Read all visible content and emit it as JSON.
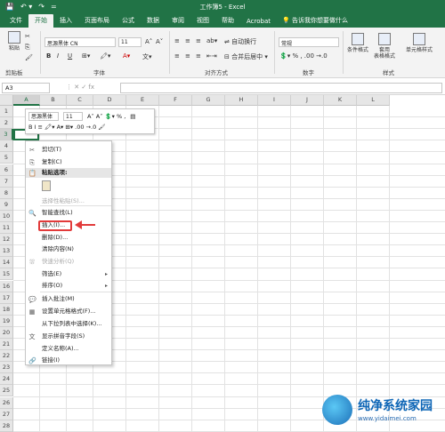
{
  "window": {
    "title": "工作簿5 - Excel"
  },
  "qat": [
    "💾",
    "↶ ▾",
    "↷",
    "="
  ],
  "tabs": [
    "文件",
    "开始",
    "插入",
    "页面布局",
    "公式",
    "数据",
    "审阅",
    "视图",
    "帮助",
    "Acrobat"
  ],
  "tell_me": "💡 告诉我你想要做什么",
  "ribbon": {
    "paste_label": "粘贴",
    "font_name": "思源黑体 CN",
    "font_size": "11",
    "autowrap": "自动换行",
    "merge": "合并后居中 ▾",
    "number_format": "常规",
    "cond_format": "条件格式",
    "table_format": "套用\n表格格式",
    "cell_style": "单元格样式",
    "groups": {
      "clipboard": "剪贴板",
      "font": "字体",
      "alignment": "对齐方式",
      "number": "数字",
      "styles": "样式"
    }
  },
  "formula_bar": {
    "namebox": "A3",
    "icons": "⋮  ✕  ✓  fx"
  },
  "columns": [
    "A",
    "B",
    "C",
    "D",
    "E",
    "F",
    "G",
    "H",
    "I",
    "J",
    "K",
    "L"
  ],
  "rows": [
    "1",
    "2",
    "3",
    "4",
    "5",
    "6",
    "7",
    "8",
    "9",
    "10",
    "11",
    "12",
    "13",
    "14",
    "15",
    "16",
    "17",
    "18",
    "19",
    "20",
    "21",
    "22",
    "23",
    "24",
    "25",
    "26",
    "27",
    "28"
  ],
  "mini_toolbar": {
    "font_name": "思源黑体",
    "font_size": "11",
    "row1_tail": "A˄ A˅ 💲▾ % ,",
    "row2": "B I ≡ 🖍▾ A▾ ⊞▾ .00 →.0 🖌"
  },
  "context_menu": {
    "items": [
      {
        "icon": "✂",
        "label": "剪切(T)",
        "disabled": false
      },
      {
        "icon": "⎘",
        "label": "复制(C)",
        "disabled": false
      },
      {
        "icon": "📋",
        "label": "粘贴选项:",
        "disabled": false,
        "header": true
      },
      {
        "icon": "",
        "label": "",
        "disabled": false,
        "paste_icon": true
      },
      {
        "icon": "",
        "label": "选择性粘贴(S)...",
        "disabled": true
      },
      {
        "icon": "🔍",
        "label": "智能查找(L)",
        "disabled": false
      },
      {
        "icon": "",
        "label": "插入(I)...",
        "disabled": false
      },
      {
        "icon": "",
        "label": "删除(D)...",
        "disabled": false
      },
      {
        "icon": "",
        "label": "清除内容(N)",
        "disabled": false
      },
      {
        "icon": "⛆",
        "label": "快速分析(Q)",
        "disabled": true
      },
      {
        "icon": "",
        "label": "筛选(E)",
        "disabled": false,
        "submenu": true
      },
      {
        "icon": "",
        "label": "排序(O)",
        "disabled": false,
        "submenu": true
      },
      {
        "icon": "💬",
        "label": "插入批注(M)",
        "disabled": false
      },
      {
        "icon": "▦",
        "label": "设置单元格格式(F)...",
        "disabled": false
      },
      {
        "icon": "",
        "label": "从下拉列表中选择(K)...",
        "disabled": false
      },
      {
        "icon": "文",
        "label": "显示拼音字段(S)",
        "disabled": false
      },
      {
        "icon": "",
        "label": "定义名称(A)...",
        "disabled": false
      },
      {
        "icon": "🔗",
        "label": "链接(I)",
        "disabled": false
      }
    ],
    "submenu_arrow": "▸"
  },
  "watermark": {
    "title": "纯净系统家园",
    "url": "www.yidaimei.com"
  }
}
